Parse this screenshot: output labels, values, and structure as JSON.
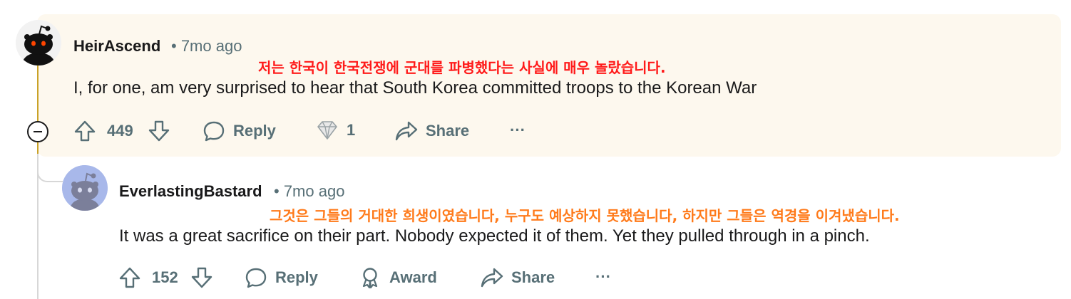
{
  "comment1": {
    "author": "HeirAscend",
    "meta": "• 7mo ago",
    "translation": "저는 한국이 한국전쟁에 군대를 파병했다는 사실에 매우 놀랐습니다.",
    "body": "I, for one, am very surprised to hear that South Korea committed troops to the Korean War",
    "votes": "449",
    "reply_label": "Reply",
    "award_count": "1",
    "share_label": "Share",
    "more_label": "···"
  },
  "comment2": {
    "author": "EverlastingBastard",
    "meta": "• 7mo ago",
    "translation": "그것은 그들의 거대한 희생이였습니다, 누구도 예상하지 못했습니다, 하지만 그들은 역경을 이겨냈습니다.",
    "body": "It was a great sacrifice on their part. Nobody expected it of them. Yet they pulled through in a pinch.",
    "votes": "152",
    "reply_label": "Reply",
    "award_label": "Award",
    "share_label": "Share",
    "more_label": "···"
  },
  "colors": {
    "highlight_bg": "#fdf8ee",
    "thread_line": "#c9a227",
    "translation1": "#ff1a1a",
    "translation2": "#ff7a1a",
    "muted": "#576f76"
  }
}
